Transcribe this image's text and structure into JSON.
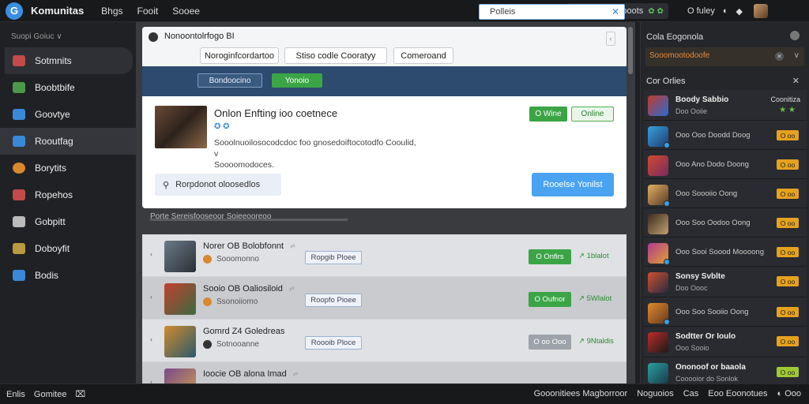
{
  "topbar": {
    "logo": "G",
    "brand": "Komunitas",
    "nav": [
      "Bhgs",
      "Fooit",
      "Sooee"
    ],
    "status_text": "Poomon Groooots",
    "status_icons": "✿ ✿",
    "right_items": [
      "O fuley",
      "◐",
      "◆"
    ]
  },
  "sidebar": {
    "header": "Suopi Goiuc  ∨",
    "items": [
      {
        "label": "Sotmnits",
        "icon": "games-icon",
        "color": "#c24a4a"
      },
      {
        "label": "Boobtbife",
        "icon": "community-icon",
        "color": "#4a9a4a"
      },
      {
        "label": "Goovtye",
        "icon": "store-icon",
        "color": "#3a88d8"
      },
      {
        "label": "Rooutfag",
        "icon": "news-icon",
        "color": "#3a88d8"
      },
      {
        "label": "Borytits",
        "icon": "profile-icon",
        "color": "#d9882e"
      },
      {
        "label": "Ropehos",
        "icon": "groups-icon",
        "color": "#c24a4a"
      },
      {
        "label": "Gobpitt",
        "icon": "market-icon",
        "color": "#bbbbbb"
      },
      {
        "label": "Doboyfit",
        "icon": "workshop-icon",
        "color": "#b89a40"
      },
      {
        "label": "Bodis",
        "icon": "library-icon",
        "color": "#3a88d8"
      }
    ]
  },
  "card": {
    "title": "Nonoontolrfogo BI",
    "tabs": [
      "Noroginfcordartoo",
      "Stiso codle Cooratyy",
      "Comeroand"
    ],
    "search_value": "Polleis",
    "scroll_up": "‹",
    "band_button": "Bondoocino",
    "band_button_green": "Yonoio",
    "post_title": "Onlon Enfting ioo coetnece",
    "post_icons": "✪ ✪",
    "post_desc_line1": "Sooolnuoilosocodcdoc foo gnosedoiftocotodfo Cooulid,",
    "post_desc_line2": "v",
    "post_desc_line3": "Soooomodoces.",
    "green_pill": "O Wine",
    "outline_pill": "Online",
    "comment_placeholder": "Rorpdonot oloosedlos",
    "blue_button": "Rooelse Yonilst"
  },
  "section_label": "Porte Sereisfooseoor Soieeooreoo",
  "list": [
    {
      "title": "Norer OB Bolobfonnt",
      "tag": "›ᵒ",
      "subtitle": "Sooomonno",
      "badge": "Ropgib Ploee",
      "button": "O Onfirs",
      "button_gray": false,
      "count": "↗ 1blalot",
      "thumb": [
        "#6a7a8a",
        "#2b2f35"
      ]
    },
    {
      "title": "Sooio OB Oaliosiloid",
      "tag": "›ᵒ",
      "subtitle": "Ssonoiiomo",
      "badge": "Roopfo Pioee",
      "button": "O Oufnor",
      "button_gray": false,
      "count": "↗ 5Wlalot",
      "thumb": [
        "#c0402e",
        "#3c6a40"
      ]
    },
    {
      "title": "Gomrd Z4 Goledreas",
      "tag": "",
      "subtitle": "Sotnooanne",
      "badge": "Roooib Ploce",
      "button": "O oo Ooo",
      "button_gray": true,
      "count": "↗ 9Ntaldis",
      "thumb": [
        "#d08a2e",
        "#2a5a6a"
      ]
    },
    {
      "title": "Ioocie OB alona Imad",
      "tag": "›ᵒ",
      "subtitle": "",
      "badge": "",
      "button": "",
      "button_gray": false,
      "count": "",
      "thumb": [
        "#7a4a8a",
        "#d0a050"
      ]
    }
  ],
  "friends_panel": {
    "header1": "Cola Eogonola",
    "orange_item": "Sooomootodoofe",
    "orange_close": "✕",
    "orange_chev": "∨",
    "header2": "Cor Orlies",
    "close": "✕",
    "friends": [
      {
        "name": "Boody Sabbio",
        "status": "Doo Ooiie",
        "right": "Coonitiza",
        "star": "★ ★",
        "badge": "",
        "thumb": [
          "#c4392e",
          "#2a6ad0"
        ],
        "online": false
      },
      {
        "name": "",
        "status": "Ooo Ooo Doodd Doog",
        "badge": "O oo",
        "badge_green": false,
        "thumb": [
          "#3aa0e0",
          "#1d3d70"
        ],
        "online": true
      },
      {
        "name": "",
        "status": "Ooo Ano Dodo Doong",
        "badge": "O oo",
        "badge_green": false,
        "thumb": [
          "#d04a2e",
          "#7a2a60"
        ],
        "online": false
      },
      {
        "name": "",
        "status": "Ooo Soooiio Oong",
        "badge": "O oo",
        "badge_green": false,
        "thumb": [
          "#e0b060",
          "#5a3a2a"
        ],
        "online": true
      },
      {
        "name": "",
        "status": "Ooo Soo Oodoo Oong",
        "badge": "O oo",
        "badge_green": false,
        "thumb": [
          "#3a2a1e",
          "#c0a070"
        ],
        "online": false
      },
      {
        "name": "",
        "status": "Ooo Sooi Soood Moooong",
        "badge": "O oo",
        "badge_green": false,
        "thumb": [
          "#b03a90",
          "#e0a030"
        ],
        "online": true
      },
      {
        "name": "Sonsy Svblte",
        "status": "Doo Oooc",
        "badge": "O oo",
        "badge_green": false,
        "thumb": [
          "#d05030",
          "#2a2a40"
        ],
        "online": false
      },
      {
        "name": "",
        "status": "Ooo Soo Sooiio Oong",
        "badge": "O oo",
        "badge_green": false,
        "thumb": [
          "#e08a2e",
          "#6a3a1e"
        ],
        "online": true
      },
      {
        "name": "Sodtter Or Ioulo",
        "status": "Ooo Sooio",
        "badge": "O oo",
        "badge_green": false,
        "thumb": [
          "#c02a2a",
          "#1a1a1a"
        ],
        "online": false
      },
      {
        "name": "Ononoof or baaola",
        "status": "Cooooior do Sonlok",
        "badge": "O oo",
        "badge_green": true,
        "thumb": [
          "#2aa0a0",
          "#1a3a4a"
        ],
        "online": false
      }
    ]
  },
  "bottombar": {
    "left": [
      "Enlis",
      "Gomitee",
      "⌧"
    ],
    "right": [
      "Gooonitiees Magborroor",
      "Noguoios",
      "Cas",
      "Eoo Eoonotues",
      "◐ Ooo"
    ]
  }
}
